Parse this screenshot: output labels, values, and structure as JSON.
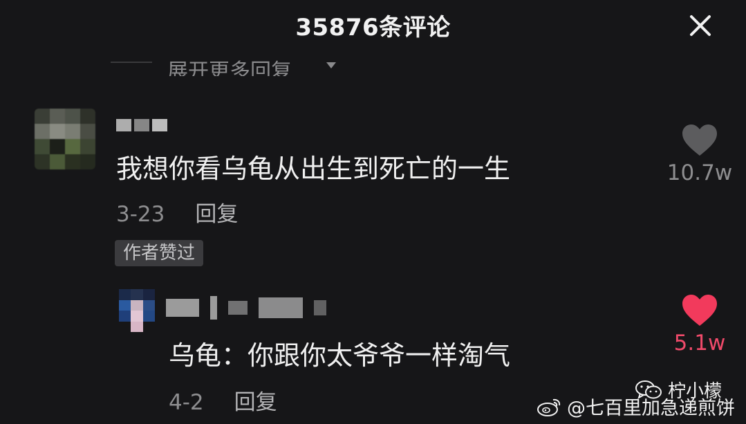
{
  "header": {
    "title": "35876条评论"
  },
  "expand_replies": {
    "label": "展开更多回复"
  },
  "comments": [
    {
      "text": "我想你看乌龟从出生到死亡的一生",
      "date": "3-23",
      "reply_label": "回复",
      "badge": "作者赞过",
      "likes": "10.7w",
      "liked": false
    },
    {
      "text": "乌龟：你跟你太爷爷一样淘气",
      "date": "4-2",
      "reply_label": "回复",
      "likes": "5.1w",
      "liked": true
    }
  ],
  "colors": {
    "background": "#161618",
    "heart_inactive": "#5c5c5e",
    "heart_active": "#f23a5c",
    "liked_count": "#f04a6a"
  },
  "icons": {
    "close": "close-icon",
    "heart": "heart-icon",
    "caret": "caret-down-icon",
    "wechat": "wechat-icon",
    "weibo": "weibo-icon"
  },
  "watermark": {
    "wechat_name": "柠小檬",
    "weibo_handle": "@七百里加急递煎饼"
  }
}
